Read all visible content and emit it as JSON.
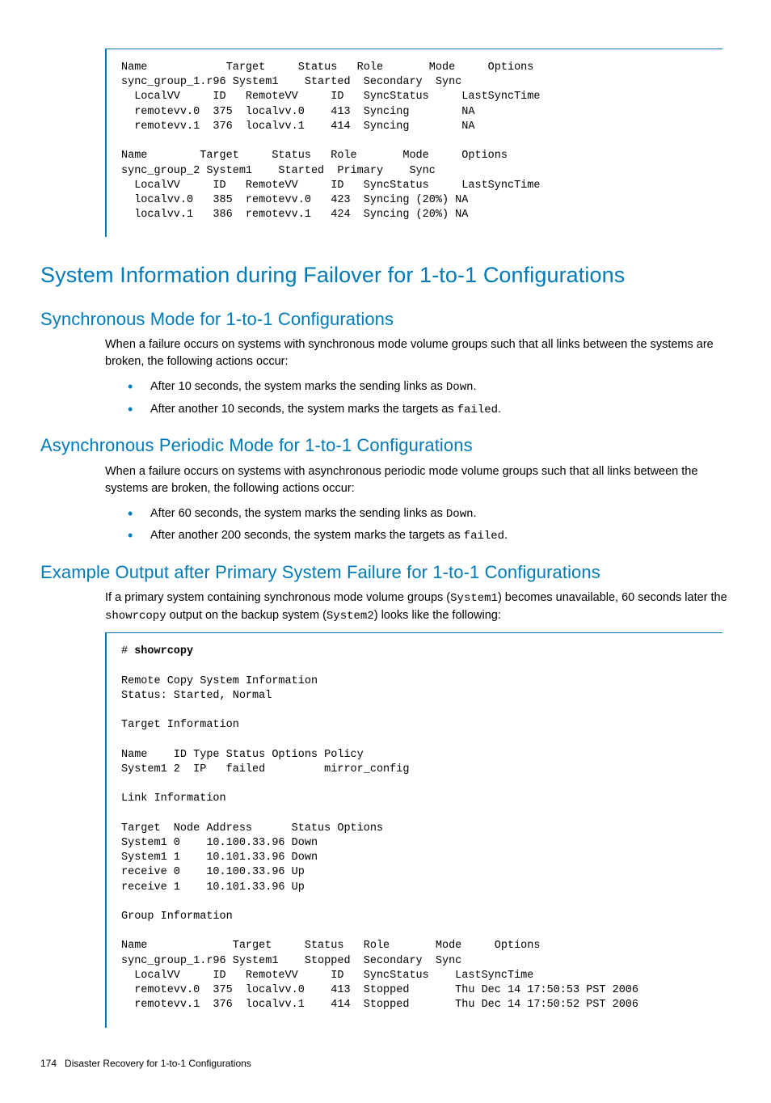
{
  "code1": "Name            Target     Status   Role       Mode     Options\nsync_group_1.r96 System1    Started  Secondary  Sync\n  LocalVV     ID   RemoteVV     ID   SyncStatus     LastSyncTime\n  remotevv.0  375  localvv.0    413  Syncing        NA\n  remotevv.1  376  localvv.1    414  Syncing        NA\n\nName        Target     Status   Role       Mode     Options\nsync_group_2 System1    Started  Primary    Sync\n  LocalVV     ID   RemoteVV     ID   SyncStatus     LastSyncTime\n  localvv.0   385  remotevv.0   423  Syncing (20%) NA\n  localvv.1   386  remotevv.1   424  Syncing (20%) NA",
  "h_main": "System Information during Failover for 1-to-1 Configurations",
  "sync": {
    "heading": "Synchronous Mode for 1-to-1 Configurations",
    "intro": "When a failure occurs on systems with synchronous mode volume groups such that all links between the systems are broken, the following actions occur:",
    "b1_pre": "After 10 seconds, the system marks the sending links as ",
    "b1_code": "Down",
    "b1_post": ".",
    "b2_pre": "After another 10 seconds, the system marks the targets as ",
    "b2_code": "failed",
    "b2_post": "."
  },
  "async": {
    "heading": "Asynchronous Periodic Mode for 1-to-1 Configurations",
    "intro": "When a failure occurs on systems with asynchronous periodic mode volume groups such that all links between the systems are broken, the following actions occur:",
    "b1_pre": "After 60 seconds, the system marks the sending links as ",
    "b1_code": "Down",
    "b1_post": ".",
    "b2_pre": "After another 200 seconds, the system marks the targets as ",
    "b2_code": "failed",
    "b2_post": "."
  },
  "example": {
    "heading": "Example Output after Primary System Failure for 1-to-1 Configurations",
    "p_pre": "If a primary system containing synchronous mode volume groups (",
    "p_c1": "System1",
    "p_mid1": ") becomes unavailable, 60 seconds later the ",
    "p_c2": "showrcopy",
    "p_mid2": " output on the backup system (",
    "p_c3": "System2",
    "p_post": ") looks like the following:"
  },
  "code2_prompt": "# ",
  "code2_cmd": "showrcopy",
  "code2_body": "\n\nRemote Copy System Information\nStatus: Started, Normal\n\nTarget Information\n\nName    ID Type Status Options Policy\nSystem1 2  IP   failed         mirror_config\n\nLink Information\n\nTarget  Node Address      Status Options\nSystem1 0    10.100.33.96 Down\nSystem1 1    10.101.33.96 Down\nreceive 0    10.100.33.96 Up\nreceive 1    10.101.33.96 Up\n\nGroup Information\n\nName             Target     Status   Role       Mode     Options\nsync_group_1.r96 System1    Stopped  Secondary  Sync\n  LocalVV     ID   RemoteVV     ID   SyncStatus    LastSyncTime\n  remotevv.0  375  localvv.0    413  Stopped       Thu Dec 14 17:50:53 PST 2006\n  remotevv.1  376  localvv.1    414  Stopped       Thu Dec 14 17:50:52 PST 2006",
  "footer": {
    "page": "174",
    "title": "Disaster Recovery for 1-to-1 Configurations"
  }
}
